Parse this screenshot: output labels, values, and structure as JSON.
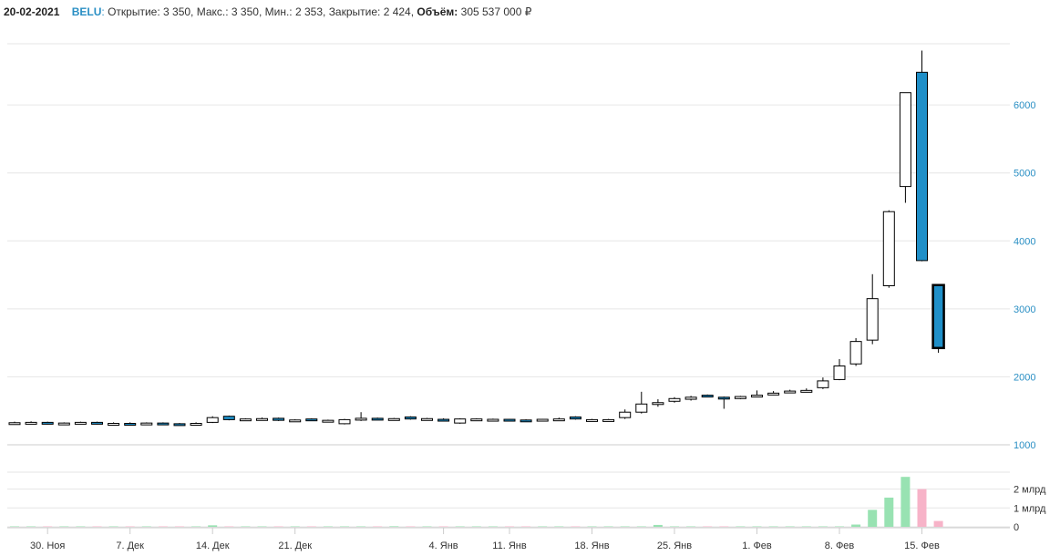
{
  "header": {
    "date": "20-02-2021",
    "ticker": "BELU",
    "colon": ":",
    "open": "Открытие: 3 350,",
    "high": "Макс.: 3 350,",
    "low": "Мин.: 2 353,",
    "close": "Закрытие: 2 424,",
    "volume_label": "Объём:",
    "volume_value": "305 537 000 ₽"
  },
  "colors": {
    "up_fill": "#ffffff",
    "down_fill": "#1f8fc8",
    "candle_stroke": "#000000",
    "grid": "#e6e6e6",
    "price_axis_text": "#2a8fc4",
    "volume_up": "#98e2b2",
    "volume_down": "#f7b3c8"
  },
  "chart_data": {
    "type": "candlestick",
    "price_ticks": [
      "1000",
      "2000",
      "3000",
      "4000",
      "5000",
      "6000"
    ],
    "price_tick_values": [
      1000,
      2000,
      3000,
      4000,
      5000,
      6000
    ],
    "price_range": [
      1000,
      6900
    ],
    "volume_ticks": [
      "0",
      "1 млрд",
      "2 млрд"
    ],
    "volume_tick_values": [
      0,
      1,
      2
    ],
    "volume_unit": "млрд ₽",
    "volume_range": [
      0,
      2.9
    ],
    "date_labels": [
      {
        "label": "30. Ноя",
        "index": 2
      },
      {
        "label": "7. Дек",
        "index": 7
      },
      {
        "label": "14. Дек",
        "index": 12
      },
      {
        "label": "21. Дек",
        "index": 17
      },
      {
        "label": "4. Янв",
        "index": 26
      },
      {
        "label": "11. Янв",
        "index": 30
      },
      {
        "label": "18. Янв",
        "index": 35
      },
      {
        "label": "25. Янв",
        "index": 40
      },
      {
        "label": "1. Фев",
        "index": 45
      },
      {
        "label": "8. Фев",
        "index": 50
      },
      {
        "label": "15. Фев",
        "index": 55
      }
    ],
    "candles": [
      [
        1320,
        1340,
        1315,
        1325
      ],
      [
        1325,
        1345,
        1315,
        1330
      ],
      [
        1330,
        1340,
        1300,
        1310
      ],
      [
        1310,
        1330,
        1300,
        1320
      ],
      [
        1320,
        1340,
        1310,
        1330
      ],
      [
        1330,
        1340,
        1300,
        1310
      ],
      [
        1310,
        1330,
        1295,
        1315
      ],
      [
        1315,
        1330,
        1300,
        1310
      ],
      [
        1310,
        1330,
        1300,
        1320
      ],
      [
        1320,
        1330,
        1300,
        1310
      ],
      [
        1310,
        1320,
        1295,
        1305
      ],
      [
        1305,
        1330,
        1295,
        1315
      ],
      [
        1330,
        1420,
        1320,
        1400
      ],
      [
        1420,
        1430,
        1360,
        1370
      ],
      [
        1370,
        1390,
        1355,
        1380
      ],
      [
        1370,
        1400,
        1355,
        1385
      ],
      [
        1390,
        1400,
        1350,
        1360
      ],
      [
        1360,
        1375,
        1345,
        1365
      ],
      [
        1380,
        1390,
        1350,
        1360
      ],
      [
        1350,
        1370,
        1330,
        1360
      ],
      [
        1310,
        1380,
        1300,
        1370
      ],
      [
        1370,
        1480,
        1350,
        1390
      ],
      [
        1390,
        1400,
        1370,
        1380
      ],
      [
        1380,
        1395,
        1365,
        1385
      ],
      [
        1410,
        1420,
        1370,
        1380
      ],
      [
        1380,
        1395,
        1365,
        1385
      ],
      [
        1375,
        1390,
        1355,
        1365
      ],
      [
        1320,
        1390,
        1310,
        1380
      ],
      [
        1370,
        1390,
        1355,
        1380
      ],
      [
        1370,
        1385,
        1355,
        1375
      ],
      [
        1375,
        1380,
        1350,
        1360
      ],
      [
        1365,
        1375,
        1355,
        1360
      ],
      [
        1370,
        1380,
        1360,
        1375
      ],
      [
        1360,
        1400,
        1350,
        1380
      ],
      [
        1410,
        1420,
        1370,
        1380
      ],
      [
        1360,
        1380,
        1345,
        1370
      ],
      [
        1360,
        1380,
        1345,
        1370
      ],
      [
        1400,
        1520,
        1380,
        1480
      ],
      [
        1480,
        1780,
        1460,
        1600
      ],
      [
        1600,
        1670,
        1560,
        1620
      ],
      [
        1640,
        1700,
        1620,
        1680
      ],
      [
        1670,
        1720,
        1650,
        1700
      ],
      [
        1730,
        1740,
        1700,
        1710
      ],
      [
        1700,
        1710,
        1530,
        1695
      ],
      [
        1680,
        1720,
        1670,
        1710
      ],
      [
        1710,
        1800,
        1700,
        1730
      ],
      [
        1740,
        1790,
        1730,
        1760
      ],
      [
        1770,
        1810,
        1760,
        1790
      ],
      [
        1790,
        1830,
        1780,
        1800
      ],
      [
        1840,
        1990,
        1820,
        1940
      ],
      [
        1960,
        2260,
        1950,
        2160
      ],
      [
        2190,
        2570,
        2160,
        2520
      ],
      [
        2540,
        3510,
        2480,
        3150
      ],
      [
        3340,
        4450,
        3310,
        4430
      ],
      [
        4800,
        6170,
        4560,
        6180
      ],
      [
        6480,
        6800,
        3700,
        3710
      ],
      [
        3350,
        3350,
        2353,
        2424
      ]
    ],
    "volumes": [
      0.01,
      0.005,
      0.005,
      0.005,
      0.005,
      0.005,
      0.005,
      0.005,
      0.005,
      0.005,
      0.005,
      0.005,
      0.08,
      0.005,
      0.005,
      0.005,
      0.005,
      0.005,
      0.005,
      0.005,
      0.005,
      0.005,
      0.005,
      0.03,
      0.005,
      0.005,
      0.005,
      0.005,
      0.005,
      0.005,
      0.005,
      0.005,
      0.005,
      0.005,
      0.005,
      0.005,
      0.005,
      0.005,
      0.005,
      0.1,
      0.01,
      0.01,
      0.01,
      0.01,
      0.01,
      0.01,
      0.01,
      0.01,
      0.01,
      0.01,
      0.01,
      0.12,
      0.9,
      1.55,
      2.65,
      2.0,
      0.31
    ],
    "volume_up": [
      true,
      true,
      false,
      true,
      true,
      false,
      true,
      false,
      true,
      false,
      false,
      true,
      true,
      false,
      true,
      true,
      false,
      true,
      false,
      true,
      true,
      true,
      false,
      true,
      false,
      true,
      false,
      true,
      true,
      true,
      false,
      false,
      true,
      true,
      false,
      true,
      true,
      true,
      true,
      true,
      true,
      true,
      false,
      false,
      true,
      true,
      true,
      true,
      true,
      true,
      true,
      true,
      true,
      true,
      true,
      false,
      false
    ]
  }
}
